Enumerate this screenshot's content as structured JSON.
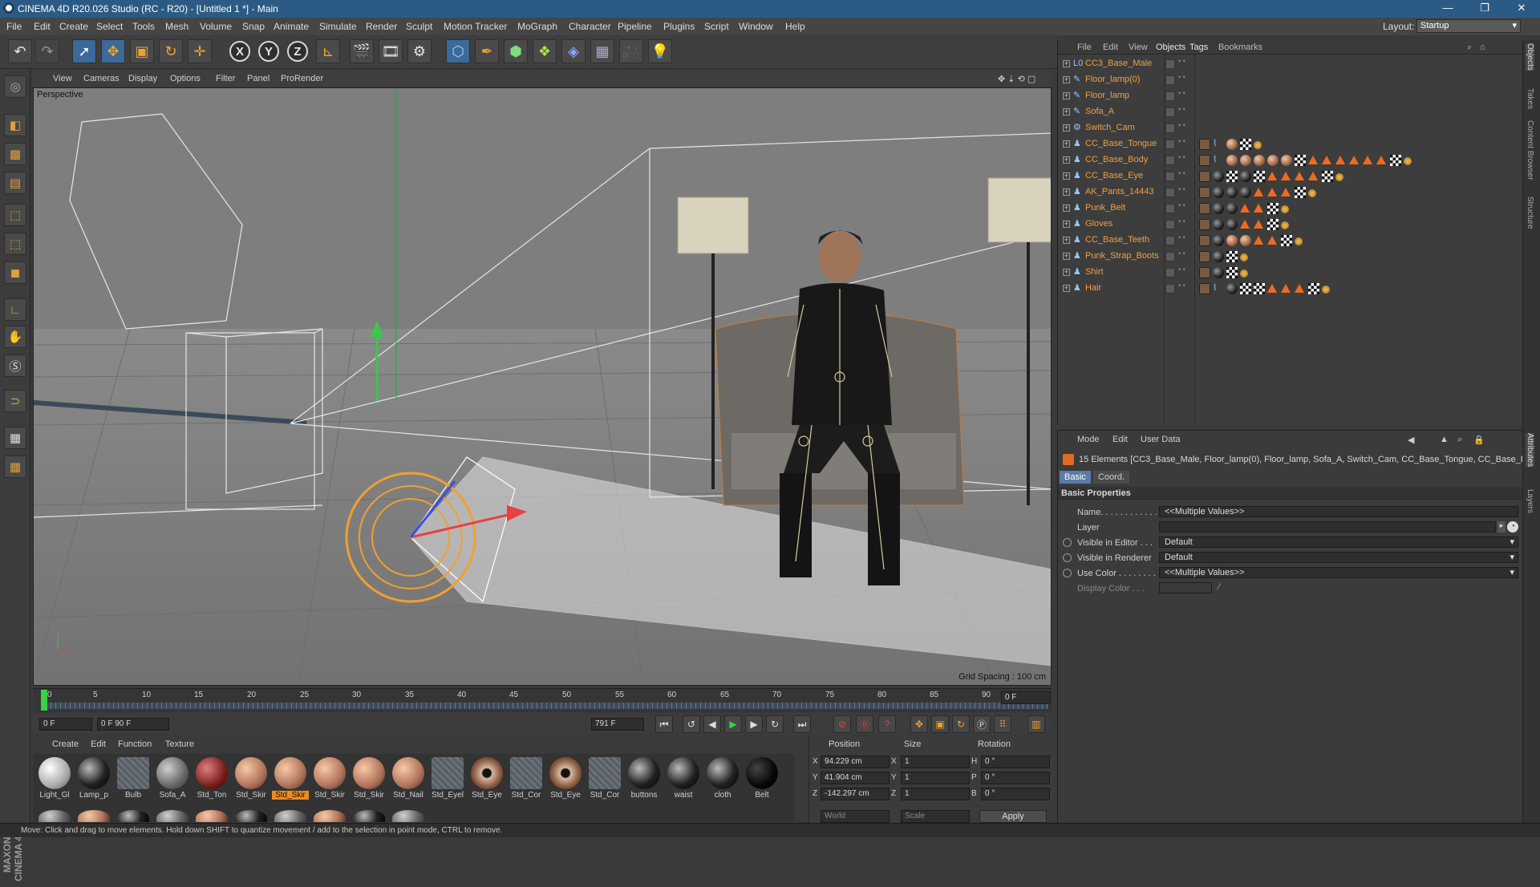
{
  "window": {
    "title": "CINEMA 4D R20.026 Studio (RC - R20) - [Untitled 1 *] - Main",
    "controls": [
      "—",
      "❐",
      "✕"
    ]
  },
  "menubar": {
    "items": [
      "File",
      "Edit",
      "Create",
      "Select",
      "Tools",
      "Mesh",
      "Volume",
      "Snap",
      "Animate",
      "Simulate",
      "Render",
      "Sculpt",
      "Motion Tracker",
      "MoGraph",
      "Character",
      "Pipeline",
      "Plugins",
      "Script",
      "Window",
      "Help"
    ],
    "layout_label": "Layout:",
    "layout_value": "Startup"
  },
  "viewport": {
    "menu": [
      "View",
      "Cameras",
      "Display",
      "Options",
      "Filter",
      "Panel",
      "ProRender"
    ],
    "label": "Perspective",
    "grid_spacing": "Grid Spacing : 100 cm"
  },
  "timeline": {
    "ticks": [
      "0",
      "5",
      "10",
      "15",
      "20",
      "25",
      "30",
      "35",
      "40",
      "45",
      "50",
      "55",
      "60",
      "65",
      "70",
      "75",
      "80",
      "85",
      "90"
    ],
    "current_frame": "0 F",
    "start_field": "0 F",
    "range_field": "0 F          90 F",
    "end_field": "791 F"
  },
  "materials": {
    "menu": [
      "Create",
      "Edit",
      "Function",
      "Texture"
    ],
    "items": [
      {
        "label": "Light_Gl",
        "kind": "light"
      },
      {
        "label": "Lamp_p",
        "kind": "dark"
      },
      {
        "label": "Bulb",
        "kind": "grid"
      },
      {
        "label": "Sofa_A",
        "kind": "grey"
      },
      {
        "label": "Std_Ton",
        "kind": "red"
      },
      {
        "label": "Std_Skir",
        "kind": "skin"
      },
      {
        "label": "Std_Skir",
        "kind": "skin",
        "selected": true
      },
      {
        "label": "Std_Skir",
        "kind": "skin"
      },
      {
        "label": "Std_Skir",
        "kind": "skin"
      },
      {
        "label": "Std_Nail",
        "kind": "skin"
      },
      {
        "label": "Std_Eyel",
        "kind": "grid"
      },
      {
        "label": "Std_Eye",
        "kind": "eye"
      },
      {
        "label": "Std_Cor",
        "kind": "grid"
      },
      {
        "label": "Std_Eye",
        "kind": "eye"
      },
      {
        "label": "Std_Cor",
        "kind": "grid"
      },
      {
        "label": "buttons",
        "kind": "dark"
      },
      {
        "label": "waist",
        "kind": "dark"
      },
      {
        "label": "cloth",
        "kind": "dark"
      },
      {
        "label": "Belt",
        "kind": "black"
      }
    ]
  },
  "coords": {
    "headers": [
      "Position",
      "Size",
      "Rotation"
    ],
    "rows": [
      {
        "axis": "X",
        "pos": "94.229 cm",
        "size_axis": "X",
        "size": "1",
        "rot_axis": "H",
        "rot": "0 °"
      },
      {
        "axis": "Y",
        "pos": "41.904 cm",
        "size_axis": "Y",
        "size": "1",
        "rot_axis": "P",
        "rot": "0 °"
      },
      {
        "axis": "Z",
        "pos": "-142.297 cm",
        "size_axis": "Z",
        "size": "1",
        "rot_axis": "B",
        "rot": "0 °"
      }
    ],
    "space": "World",
    "mode": "Scale",
    "apply": "Apply"
  },
  "objects": {
    "menu": [
      "File",
      "Edit",
      "View",
      "Objects",
      "Tags",
      "Bookmarks"
    ],
    "rows": [
      {
        "name": "CC3_Base_Male",
        "icon": "L0",
        "tags": []
      },
      {
        "name": "Floor_lamp(0)",
        "icon": "✎",
        "tags": []
      },
      {
        "name": "Floor_lamp",
        "icon": "✎",
        "tags": []
      },
      {
        "name": "Sofa_A",
        "icon": "✎",
        "tags": []
      },
      {
        "name": "Switch_Cam",
        "icon": "⚙",
        "tags": []
      },
      {
        "name": "CC_Base_Tongue",
        "icon": "♟",
        "tags": [
          "skin",
          "bone",
          "mat",
          "chk",
          "dot"
        ]
      },
      {
        "name": "CC_Base_Body",
        "icon": "♟",
        "tags": [
          "skin",
          "bone",
          "mat",
          "mat",
          "mat",
          "mat",
          "mat",
          "chk",
          "tri",
          "tri",
          "tri",
          "tri",
          "tri",
          "tri",
          "chk",
          "dot"
        ]
      },
      {
        "name": "CC_Base_Eye",
        "icon": "♟",
        "tags": [
          "skin",
          "dark",
          "chk",
          "dark",
          "chk",
          "tri",
          "tri",
          "tri",
          "tri",
          "chk",
          "dot"
        ]
      },
      {
        "name": "AK_Pants_14443",
        "icon": "♟",
        "tags": [
          "skin",
          "dark",
          "dark",
          "dark",
          "tri",
          "tri",
          "tri",
          "chk",
          "dot"
        ]
      },
      {
        "name": "Punk_Belt",
        "icon": "♟",
        "tags": [
          "skin",
          "dark",
          "dark",
          "tri",
          "tri",
          "chk",
          "dot"
        ]
      },
      {
        "name": "Gloves",
        "icon": "♟",
        "tags": [
          "skin",
          "dark",
          "dark",
          "tri",
          "tri",
          "chk",
          "dot"
        ]
      },
      {
        "name": "CC_Base_Teeth",
        "icon": "♟",
        "tags": [
          "skin",
          "dark",
          "mat",
          "mat",
          "tri",
          "tri",
          "chk",
          "dot"
        ]
      },
      {
        "name": "Punk_Strap_Boots",
        "icon": "♟",
        "tags": [
          "skin",
          "dark",
          "chk",
          "dot"
        ]
      },
      {
        "name": "Shirt",
        "icon": "♟",
        "tags": [
          "skin",
          "dark",
          "chk",
          "dot"
        ]
      },
      {
        "name": "Hair",
        "icon": "♟",
        "tags": [
          "skin",
          "bone",
          "dark",
          "chk",
          "chk",
          "tri",
          "tri",
          "tri",
          "chk",
          "dot"
        ]
      }
    ]
  },
  "attributes": {
    "menu": [
      "Mode",
      "Edit",
      "User Data"
    ],
    "elements": "15 Elements [CC3_Base_Male, Floor_lamp(0), Floor_lamp, Sofa_A, Switch_Cam, CC_Base_Tongue, CC_Base_Bo",
    "tabs": [
      "Basic",
      "Coord."
    ],
    "section": "Basic Properties",
    "props": [
      {
        "label": "Name. . . . . . . . . . . .",
        "value": "<<Multiple Values>>",
        "radio": false
      },
      {
        "label": "Layer",
        "value": "",
        "radio": false
      },
      {
        "label": "Visible in Editor . . .",
        "value": "Default",
        "radio": true
      },
      {
        "label": "Visible in Renderer",
        "value": "Default",
        "radio": true
      },
      {
        "label": "Use Color . . . . . . . .",
        "value": "<<Multiple Values>>",
        "radio": true
      },
      {
        "label": "Display Color . . .",
        "value": "",
        "radio": false
      }
    ]
  },
  "side_tabs": [
    "Objects",
    "Takes",
    "Content Browser",
    "Structure",
    "Attributes",
    "Layers"
  ],
  "status": "Move: Click and drag to move elements. Hold down SHIFT to quantize movement / add to the selection in point mode, CTRL to remove.",
  "maxon_logo": "MAXON CINEMA 4D",
  "colors": {
    "accent": "#f0a040",
    "titlebar": "#2b5b84",
    "selection": "#f08a20"
  }
}
